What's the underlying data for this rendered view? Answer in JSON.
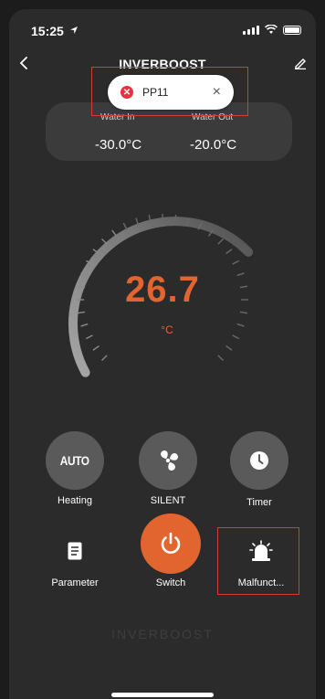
{
  "status_bar": {
    "time": "15:25"
  },
  "header": {
    "title": "INVERBOOST"
  },
  "toast": {
    "code": "PP11",
    "close": "×"
  },
  "water": {
    "in_label": "Water In",
    "out_label": "Water Out",
    "in_value": "-30.0°C",
    "out_value": "-20.0°C"
  },
  "gauge": {
    "temperature": "26.7",
    "unit": "°C"
  },
  "controls": {
    "mode_icon_text": "AUTO",
    "mode_label": "Heating",
    "fan_label": "SILENT",
    "timer_label": "Timer",
    "parameter_label": "Parameter",
    "switch_label": "Switch",
    "malfunction_label": "Malfunct..."
  },
  "brand": {
    "watermark": "INVERBOOST"
  },
  "colors": {
    "accent": "#e2642f",
    "background": "#2b2b2b",
    "button": "#5a5a5a",
    "error": "#e5323e"
  }
}
